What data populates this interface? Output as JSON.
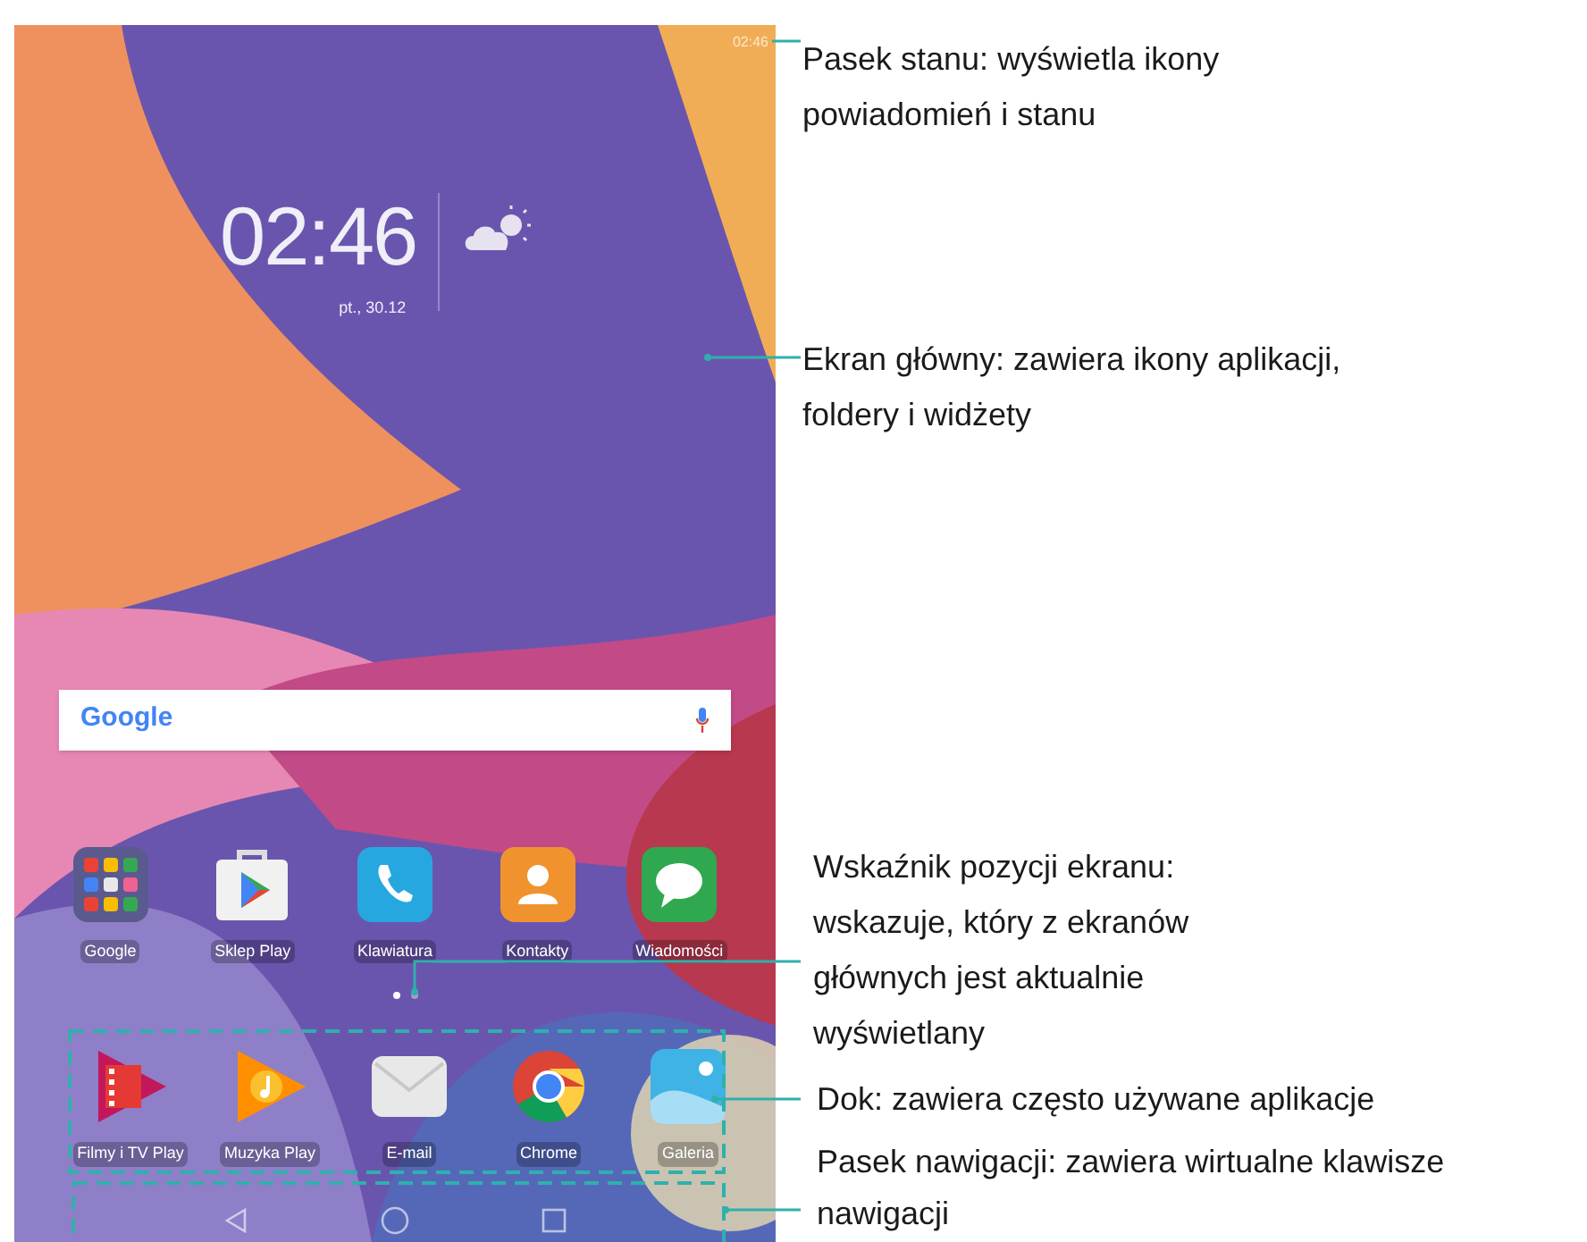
{
  "status_bar": {
    "time": "02:46"
  },
  "clock": {
    "time": "02:46",
    "date": "pt., 30.12"
  },
  "search": {
    "logo": "Google"
  },
  "apps": [
    {
      "label": "Google",
      "kind": "folder"
    },
    {
      "label": "Sklep Play",
      "kind": "store"
    },
    {
      "label": "Klawiatura",
      "kind": "phone"
    },
    {
      "label": "Kontakty",
      "kind": "contacts"
    },
    {
      "label": "Wiadomości",
      "kind": "messages"
    }
  ],
  "page_indicator": [
    {
      "selected": true
    },
    {
      "selected": false
    }
  ],
  "dock": [
    {
      "label": "Filmy i TV Play",
      "kind": "movies"
    },
    {
      "label": "Muzyka Play",
      "kind": "music"
    },
    {
      "label": "E-mail",
      "kind": "email"
    },
    {
      "label": "Chrome",
      "kind": "chrome"
    },
    {
      "label": "Galeria",
      "kind": "gallery"
    }
  ],
  "callouts": [
    {
      "text": "Pasek stanu: wyświetla ikony powiadomień i stanu"
    },
    {
      "text": "Ekran główny: zawiera ikony aplikacji, foldery i widżety"
    },
    {
      "text": "Wskaźnik pozycji ekranu: wskazuje, który z ekranów głównych jest aktualnie wyświetlany"
    },
    {
      "text": "Dok: zawiera często używane aplikacje"
    },
    {
      "text": "Pasek nawigacji: zawiera wirtualne klawisze nawigacji"
    }
  ]
}
